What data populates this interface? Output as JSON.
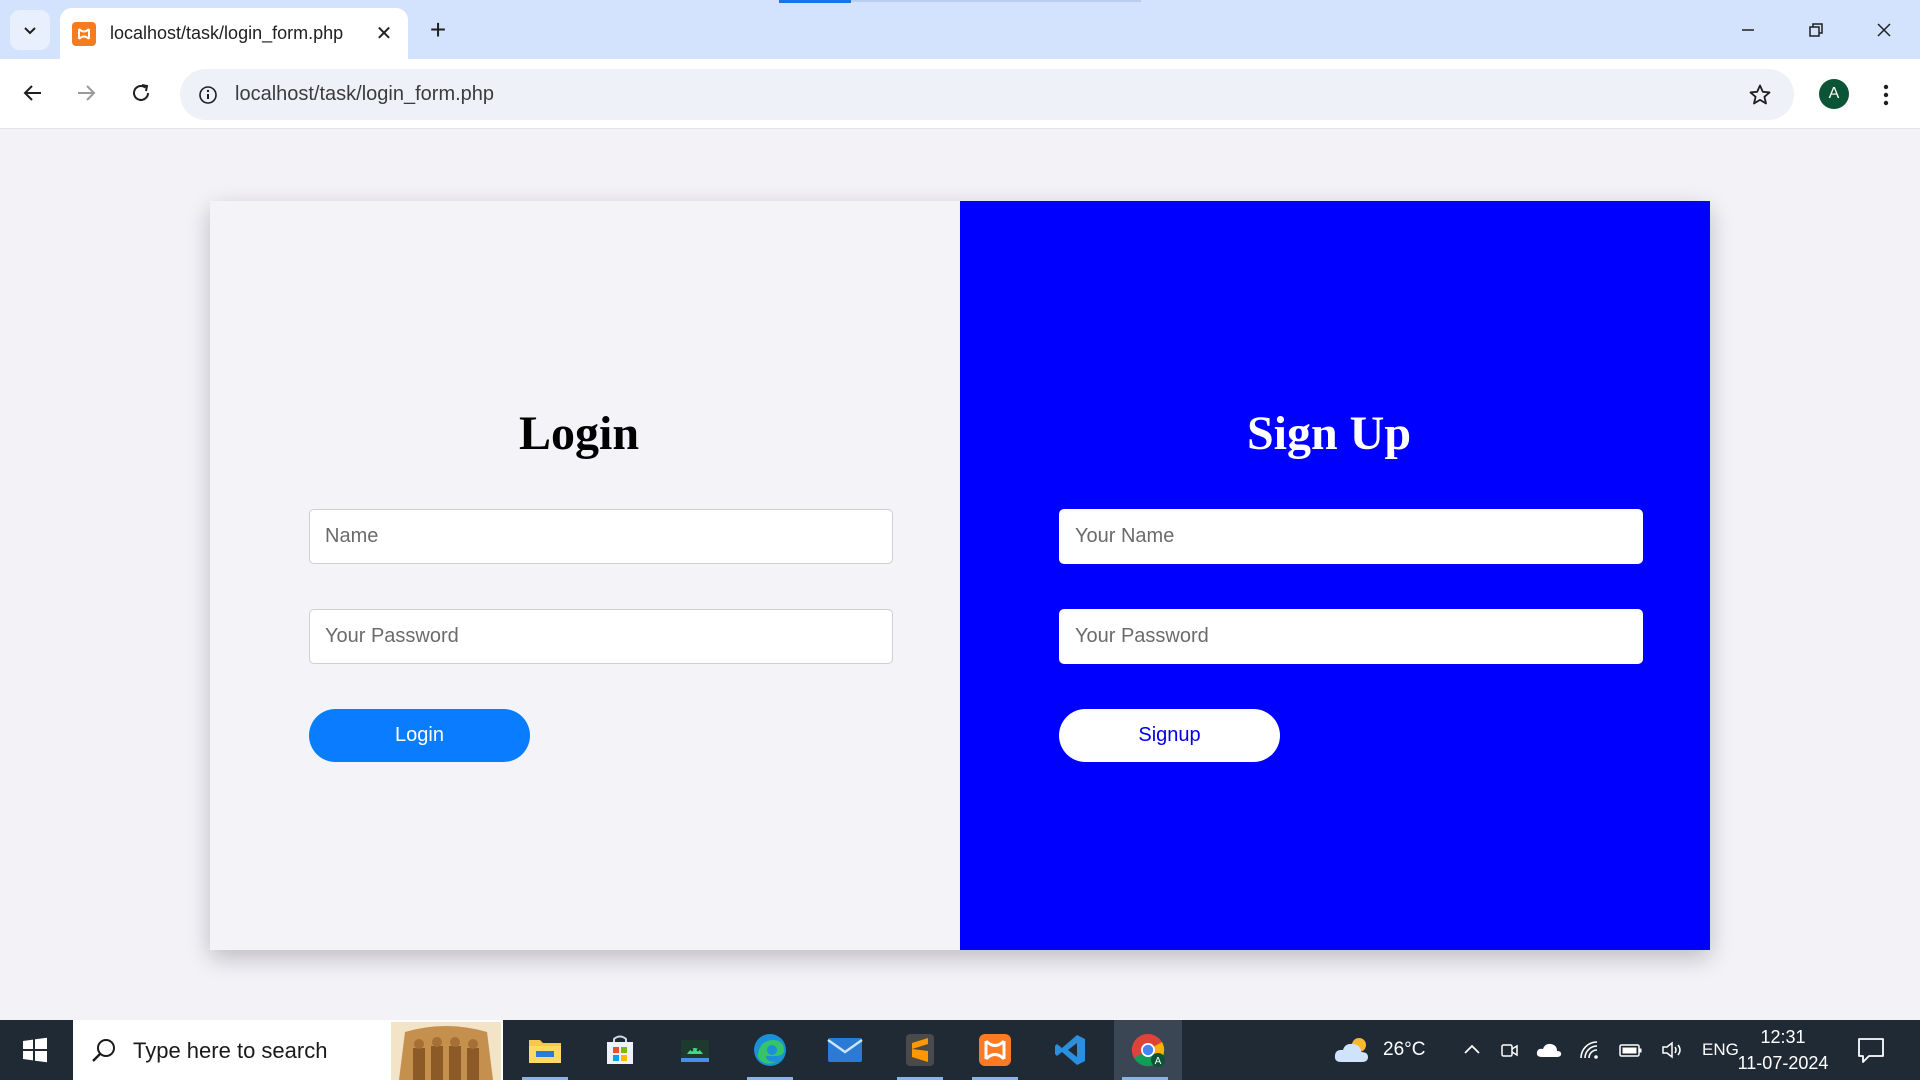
{
  "browser": {
    "tab_title": "localhost/task/login_form.php",
    "tab_close_glyph": "✕",
    "new_tab_glyph": "+",
    "url": "localhost/task/login_form.php",
    "profile_initial": "A"
  },
  "login": {
    "heading": "Login",
    "name_placeholder": "Name",
    "password_placeholder": "Your Password",
    "button_label": "Login"
  },
  "signup": {
    "heading": "Sign Up",
    "name_placeholder": "Your Name",
    "password_placeholder": "Your Password",
    "button_label": "Signup"
  },
  "taskbar": {
    "search_placeholder": "Type here to search",
    "apps": [
      "file-explorer",
      "microsoft-store",
      "android-studio",
      "edge",
      "mail",
      "sublime-text",
      "xampp",
      "vscode",
      "chrome"
    ],
    "weather_temp": "26°C",
    "language": "ENG",
    "time": "12:31",
    "date": "11-07-2024"
  },
  "colors": {
    "login_panel": "#f4f3f8",
    "signup_panel": "#0000ff",
    "login_button": "#0a7cff",
    "tabstrip": "#d3e3fd",
    "taskbar": "#202a35"
  }
}
